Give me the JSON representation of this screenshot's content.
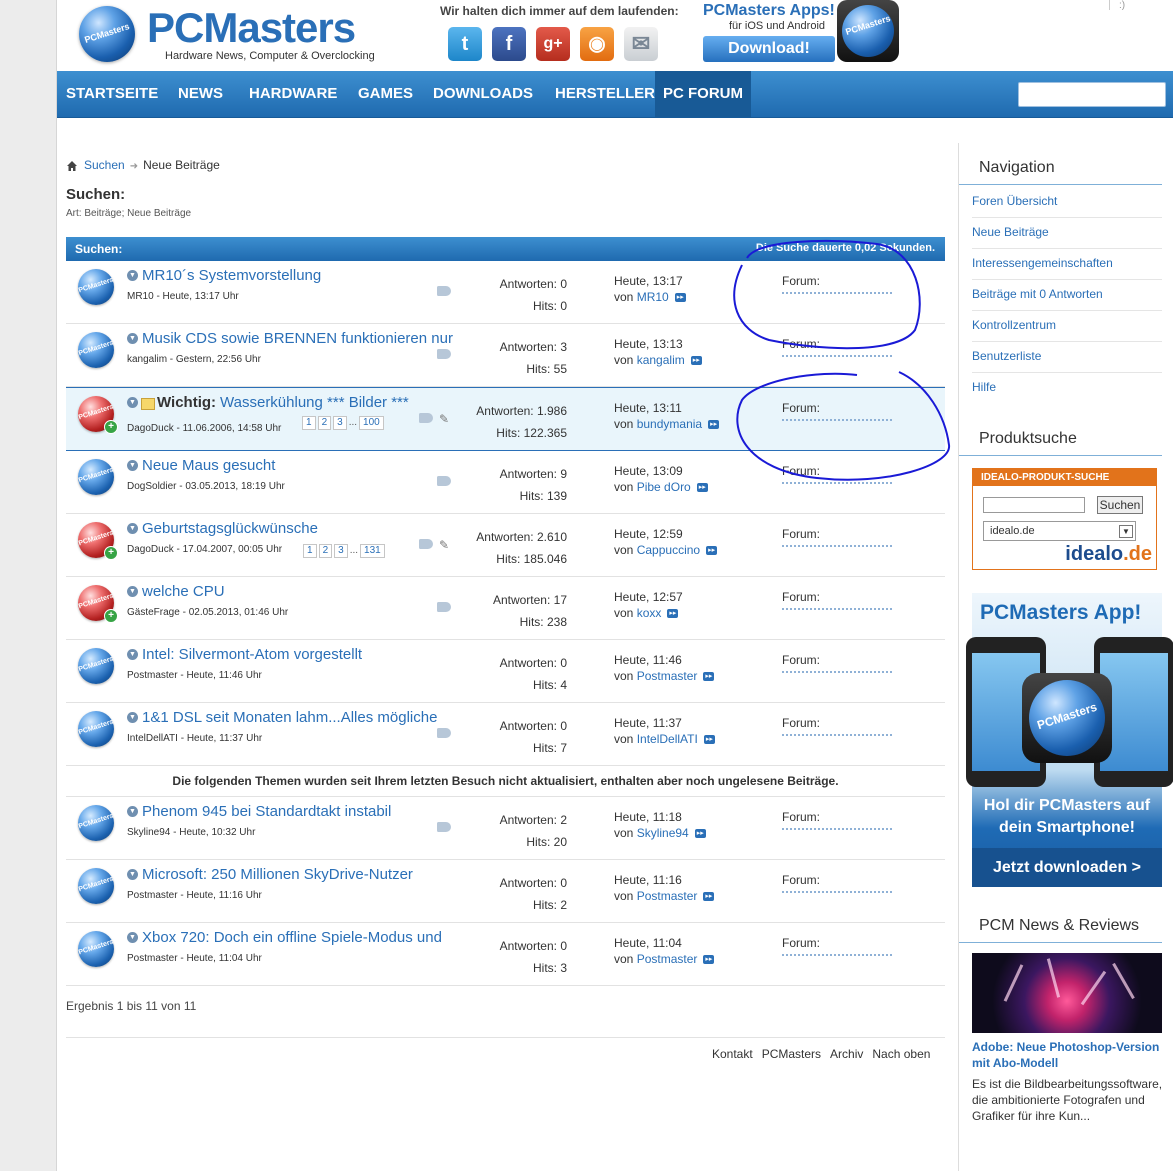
{
  "header": {
    "logo_title": "PCMasters",
    "logo_sub": "Hardware News, Computer & Overclocking",
    "logo_ball": "PCMasters",
    "social_caption": "Wir halten dich immer auf dem laufenden:",
    "social": [
      "twitter-icon",
      "facebook-icon",
      "google-plus-icon",
      "rss-icon",
      "mail-icon"
    ],
    "apps_title": "PCMasters Apps!",
    "apps_sub": "für iOS und Android",
    "apps_button": "Download!",
    "corner_mark": ":)"
  },
  "nav": {
    "items": [
      "STARTSEITE",
      "NEWS",
      "HARDWARE",
      "GAMES",
      "DOWNLOADS",
      "HERSTELLER",
      "PC FORUM"
    ],
    "active": "PC FORUM",
    "search_placeholder": ""
  },
  "breadcrumb": {
    "home": "home-icon",
    "link": "Suchen",
    "current": "Neue Beiträge"
  },
  "page": {
    "heading": "Suchen:",
    "art": "Art: Beiträge; Neue Beiträge"
  },
  "table": {
    "header_left": "Suchen:",
    "header_right": "Die Suche dauerte 0,02 Sekunden.",
    "threads": [
      {
        "title": "MR10´s Systemvorstellung",
        "meta": "MR10 - Heute, 13:17 Uhr",
        "replies": "Antworten: 0",
        "hits": "Hits: 0",
        "last_time": "Heute, 13:17",
        "last_by": "von",
        "last_user": "MR10",
        "forum": "Forum:",
        "sticky": false,
        "tag": true,
        "clip": false,
        "pages": []
      },
      {
        "title": "Musik CDS sowie BRENNEN funktionieren nur",
        "meta": "kangalim - Gestern, 22:56 Uhr",
        "replies": "Antworten: 3",
        "hits": "Hits: 55",
        "last_time": "Heute, 13:13",
        "last_by": "von",
        "last_user": "kangalim",
        "forum": "Forum:",
        "sticky": false,
        "tag": true,
        "clip": false,
        "pages": []
      },
      {
        "prefix": "Wichtig:",
        "title": "Wasserkühlung *** Bilder ***",
        "meta": "DagoDuck - 11.06.2006, 14:58 Uhr",
        "replies": "Antworten: 1.986",
        "hits": "Hits: 122.365",
        "last_time": "Heute, 13:11",
        "last_by": "von",
        "last_user": "bundymania",
        "forum": "Forum:",
        "sticky": true,
        "tag": true,
        "clip": true,
        "pages": [
          "1",
          "2",
          "3",
          "...",
          "100"
        ]
      },
      {
        "title": "Neue Maus gesucht",
        "meta": "DogSoldier - 03.05.2013, 18:19 Uhr",
        "replies": "Antworten: 9",
        "hits": "Hits: 139",
        "last_time": "Heute, 13:09",
        "last_by": "von",
        "last_user": "Pibe dOro",
        "forum": "Forum:",
        "sticky": false,
        "tag": true,
        "clip": false,
        "pages": []
      },
      {
        "title": "Geburtstagsglückwünsche",
        "meta": "DagoDuck - 17.04.2007, 00:05 Uhr",
        "replies": "Antworten: 2.610",
        "hits": "Hits: 185.046",
        "last_time": "Heute, 12:59",
        "last_by": "von",
        "last_user": "Cappuccino",
        "forum": "Forum:",
        "sticky": false,
        "red": true,
        "tag": true,
        "clip": true,
        "pages": [
          "1",
          "2",
          "3",
          "...",
          "131"
        ]
      },
      {
        "title": "welche CPU",
        "meta": "GästeFrage - 02.05.2013, 01:46 Uhr",
        "replies": "Antworten: 17",
        "hits": "Hits: 238",
        "last_time": "Heute, 12:57",
        "last_by": "von",
        "last_user": "koxx",
        "forum": "Forum:",
        "sticky": false,
        "red": true,
        "tag": true,
        "clip": false,
        "pages": []
      },
      {
        "title": "Intel: Silvermont-Atom vorgestellt",
        "meta": "Postmaster - Heute, 11:46 Uhr",
        "replies": "Antworten: 0",
        "hits": "Hits: 4",
        "last_time": "Heute, 11:46",
        "last_by": "von",
        "last_user": "Postmaster",
        "forum": "Forum:",
        "sticky": false,
        "tag": false,
        "clip": false,
        "pages": []
      },
      {
        "title": "1&1 DSL seit Monaten lahm...Alles mögliche",
        "meta": "IntelDellATI - Heute, 11:37 Uhr",
        "replies": "Antworten: 0",
        "hits": "Hits: 7",
        "last_time": "Heute, 11:37",
        "last_by": "von",
        "last_user": "IntelDellATI",
        "forum": "Forum:",
        "sticky": false,
        "tag": true,
        "clip": false,
        "pages": []
      }
    ],
    "notice": "Die folgenden Themen wurden seit Ihrem letzten Besuch nicht aktualisiert, enthalten aber noch ungelesene Beiträge.",
    "threads2": [
      {
        "title": "Phenom 945 bei Standardtakt instabil",
        "meta": "Skyline94 - Heute, 10:32 Uhr",
        "replies": "Antworten: 2",
        "hits": "Hits: 20",
        "last_time": "Heute, 11:18",
        "last_by": "von",
        "last_user": "Skyline94",
        "forum": "Forum:",
        "tag": true
      },
      {
        "title": "Microsoft: 250 Millionen SkyDrive-Nutzer",
        "meta": "Postmaster - Heute, 11:16 Uhr",
        "replies": "Antworten: 0",
        "hits": "Hits: 2",
        "last_time": "Heute, 11:16",
        "last_by": "von",
        "last_user": "Postmaster",
        "forum": "Forum:",
        "tag": false
      },
      {
        "title": "Xbox 720: Doch ein offline Spiele-Modus und",
        "meta": "Postmaster - Heute, 11:04 Uhr",
        "replies": "Antworten: 0",
        "hits": "Hits: 3",
        "last_time": "Heute, 11:04",
        "last_by": "von",
        "last_user": "Postmaster",
        "forum": "Forum:",
        "tag": false
      }
    ]
  },
  "result": "Ergebnis 1 bis 11 von 11",
  "footer": [
    "Kontakt",
    "PCMasters",
    "Archiv",
    "Nach oben"
  ],
  "sidebar": {
    "nav_title": "Navigation",
    "links": [
      "Foren Übersicht",
      "Neue Beiträge",
      "Interessengemeinschaften",
      "Beiträge mit 0 Antworten",
      "Kontrollzentrum",
      "Benutzerliste",
      "Hilfe"
    ],
    "product_title": "Produktsuche",
    "idealo_header": "IDEALO-PRODUKT-SUCHE",
    "idealo_button": "Suchen",
    "idealo_select": "idealo.de",
    "idealo_logo_a": "idealo",
    "idealo_logo_b": ".de",
    "app_title": "PCMasters App!",
    "app_logo": "PCMasters",
    "app_line1": "Hol dir PCMasters auf",
    "app_line2": "dein Smartphone!",
    "app_cta": "Jetzt downloaden >",
    "news_title": "PCM News & Reviews",
    "news_headline": "Adobe: Neue Photoshop-Version mit Abo-Modell",
    "news_text": "Es ist die Bildbearbeitungssoftware, die ambitionierte Fotografen und Grafiker für ihre Kun..."
  },
  "colors": {
    "brand_blue": "#2a6fb7",
    "nav_blue": "#1f6aaf",
    "idealo_orange": "#e2731b",
    "annotation": "#1a1ad6"
  }
}
